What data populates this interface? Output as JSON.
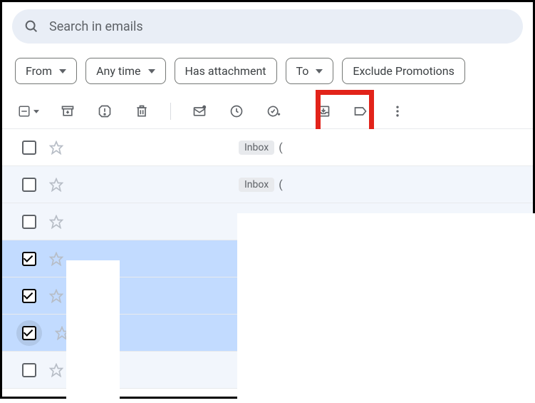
{
  "search": {
    "placeholder": "Search in emails"
  },
  "filters": {
    "from": "From",
    "anytime": "Any time",
    "attachment": "Has attachment",
    "to": "To",
    "exclude": "Exclude Promotions"
  },
  "labels": {
    "inbox": "Inbox"
  },
  "rows": [
    {
      "selected": false,
      "snippet": "("
    },
    {
      "selected": false,
      "snippet": "("
    },
    {
      "selected": true
    },
    {
      "selected": true
    },
    {
      "selected": true,
      "emphasis": true
    },
    {
      "selected": false
    }
  ]
}
